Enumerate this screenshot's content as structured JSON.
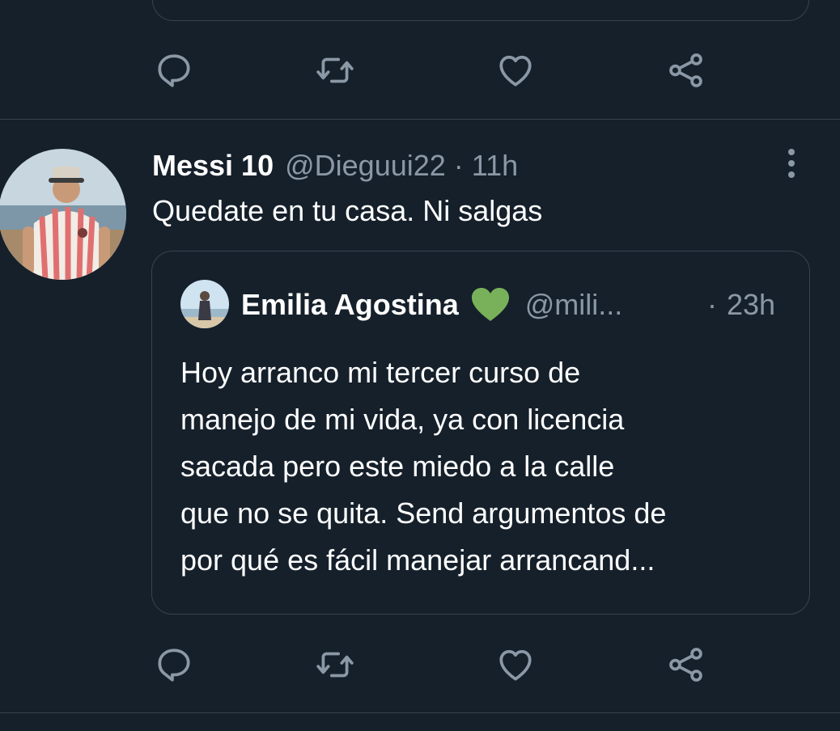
{
  "prev_tweet": {
    "actions": {
      "reply": "reply-icon",
      "retweet": "retweet-icon",
      "like": "heart-icon",
      "share": "share-icon"
    }
  },
  "tweet": {
    "display_name": "Messi 10",
    "handle": "@Dieguui22",
    "separator": "·",
    "time": "11h",
    "text": "Quedate en tu casa. Ni salgas",
    "avatar": "profile-photo"
  },
  "quoted_tweet": {
    "display_name": "Emilia Agostina",
    "emoji": "💚",
    "handle": "@mili...",
    "separator": "·",
    "time": "23h",
    "text_lines": [
      "Hoy arranco mi tercer curso de",
      "manejo de mi vida, ya con licencia",
      "sacada pero este miedo a la calle",
      "que no se quita. Send argumentos de",
      "por qué es fácil manejar arrancand..."
    ]
  },
  "colors": {
    "background": "#15202b",
    "border": "#38444d",
    "secondary_text": "#8b98a5",
    "primary_text": "#ffffff",
    "icon": "#8b98a5",
    "heart_emoji": "#78b159"
  }
}
